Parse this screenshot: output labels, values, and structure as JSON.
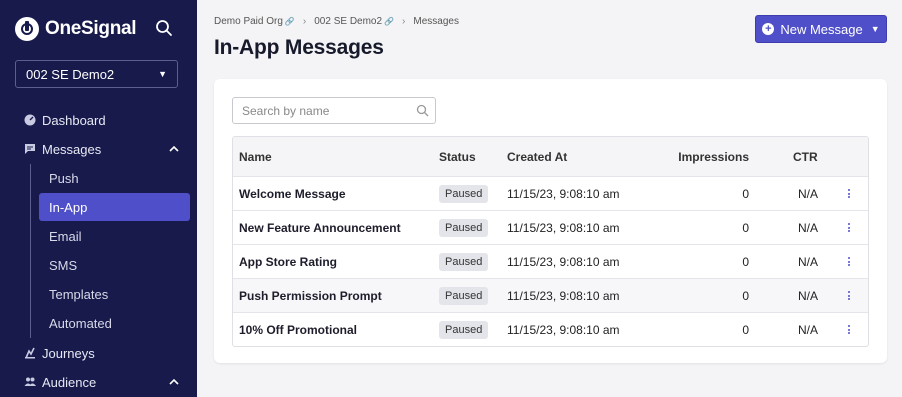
{
  "brand": {
    "name": "OneSignal"
  },
  "app_selector": {
    "value": "002 SE Demo2"
  },
  "nav": {
    "dashboard": "Dashboard",
    "messages": "Messages",
    "sub": [
      "Push",
      "In-App",
      "Email",
      "SMS",
      "Templates",
      "Automated"
    ],
    "active_sub": "In-App",
    "journeys": "Journeys",
    "audience": "Audience"
  },
  "breadcrumb": [
    "Demo Paid Org",
    "002 SE Demo2",
    "Messages"
  ],
  "page": {
    "title": "In-App Messages"
  },
  "actions": {
    "new_message": "New Message"
  },
  "search": {
    "placeholder": "Search by name"
  },
  "table": {
    "columns": [
      "Name",
      "Status",
      "Created At",
      "Impressions",
      "CTR"
    ],
    "rows": [
      {
        "name": "Welcome Message",
        "status": "Paused",
        "created": "11/15/23, 9:08:10 am",
        "impressions": "0",
        "ctr": "N/A"
      },
      {
        "name": "New Feature Announcement",
        "status": "Paused",
        "created": "11/15/23, 9:08:10 am",
        "impressions": "0",
        "ctr": "N/A"
      },
      {
        "name": "App Store Rating",
        "status": "Paused",
        "created": "11/15/23, 9:08:10 am",
        "impressions": "0",
        "ctr": "N/A"
      },
      {
        "name": "Push Permission Prompt",
        "status": "Paused",
        "created": "11/15/23, 9:08:10 am",
        "impressions": "0",
        "ctr": "N/A"
      },
      {
        "name": "10% Off Promotional",
        "status": "Paused",
        "created": "11/15/23, 9:08:10 am",
        "impressions": "0",
        "ctr": "N/A"
      }
    ]
  },
  "colors": {
    "sidebar": "#171a4a",
    "accent": "#4f4fc9"
  }
}
